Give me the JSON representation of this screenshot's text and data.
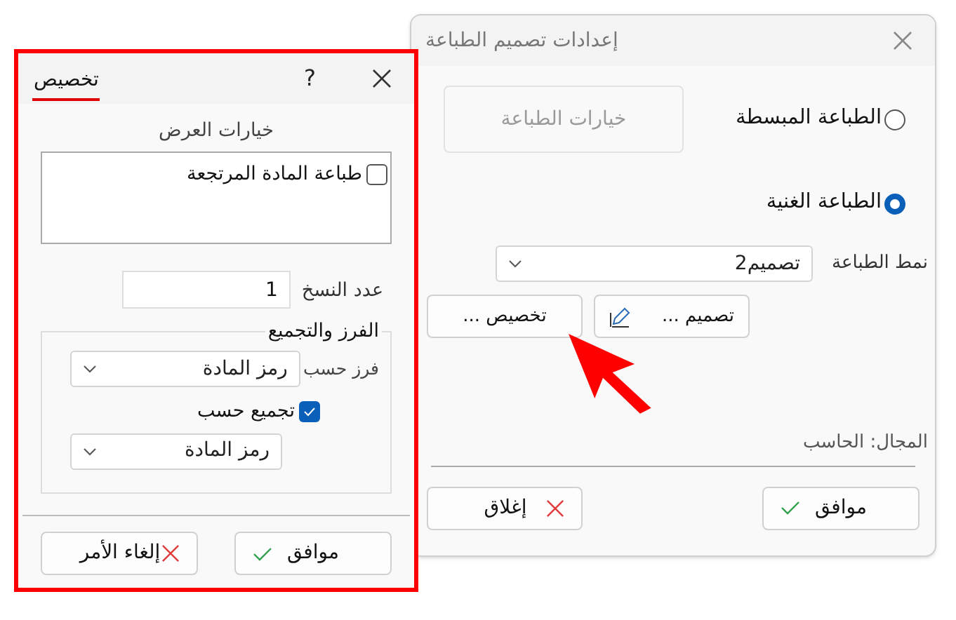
{
  "main_dialog": {
    "title": "إعدادات تصميم الطباعة",
    "print_options_button": {
      "label": "خيارات الطباعة",
      "disabled": true
    },
    "print_modes": [
      {
        "label": "الطباعة المبسطة",
        "selected": false
      },
      {
        "label": "الطباعة الغنية",
        "selected": true
      }
    ],
    "print_style": {
      "label": "نمط الطباعة",
      "value": "تصميم2"
    },
    "design_button": "تصميم ...",
    "customize_button": "تخصيص ...",
    "domain": "المجال: الحاسب",
    "ok_button": "موافق",
    "close_button": "إغلاق"
  },
  "customize_dialog": {
    "tab": {
      "label": "تخصيص",
      "selected": true
    },
    "help": "?",
    "display_options": {
      "title": "خيارات العرض",
      "items": [
        {
          "label": "طباعة المادة المرتجعة",
          "checked": false
        }
      ]
    },
    "copies": {
      "label": "عدد النسخ",
      "value": "1"
    },
    "sort_group": {
      "title": "الفرز والتجميع",
      "sort_by": {
        "label": "فرز حسب",
        "value": "رمز المادة"
      },
      "group_by": {
        "label": "تجميع حسب",
        "checked": true,
        "value": "رمز المادة"
      }
    },
    "ok_button": "موافق",
    "cancel_button": "إلغاء الأمر"
  }
}
